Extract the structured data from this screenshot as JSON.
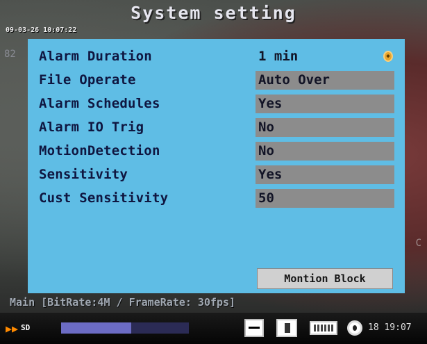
{
  "window": {
    "title": "System setting"
  },
  "overlay": {
    "timestamp": "09-03-26 10:07:22",
    "ghost_left": "82",
    "ghost_right": "C",
    "info_line": "Main [BitRate:4M / FrameRate: 30fps]"
  },
  "settings": [
    {
      "label": "Alarm Duration",
      "value": "1 min"
    },
    {
      "label": "File Operate",
      "value": "Auto Over"
    },
    {
      "label": "Alarm Schedules",
      "value": "Yes"
    },
    {
      "label": "Alarm IO Trig",
      "value": "No"
    },
    {
      "label": "MotionDetection",
      "value": "No"
    },
    {
      "label": "Sensitivity",
      "value": "Yes"
    },
    {
      "label": "Cust Sensitivity",
      "value": "50"
    }
  ],
  "buttons": {
    "motion_block": "Montion Block"
  },
  "status": {
    "play_icon": "▶▶",
    "sd_label": "SD",
    "progress": 0.55,
    "time": "18 19:07",
    "icons": [
      "keyboard-icon",
      "memory-card-icon",
      "battery-icon",
      "clock-icon"
    ]
  },
  "colors": {
    "panel": "#5fbde5",
    "value_box": "#8c8c8c",
    "label_text": "#0f1640",
    "accent_spinner": "#e8a52c"
  }
}
